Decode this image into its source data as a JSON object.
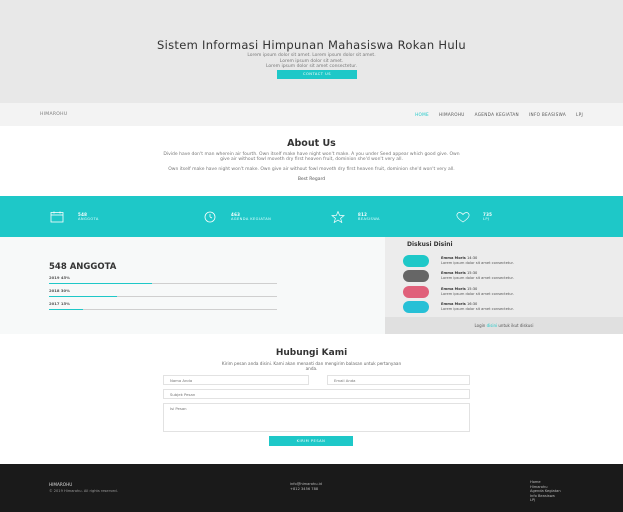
{
  "colors": {
    "accent": "#1ec8c8",
    "hero_bg": "#e8e8e8",
    "footer_bg": "#1a1a1a"
  },
  "hero": {
    "title": "Sistem Informasi Himpunan Mahasiswa Rokan Hulu",
    "subtitle_lines": [
      "Lorem ipsum dolor sit amet. Lorem ipsum dolor sit amet.",
      "Lorem ipsum dolor sit amet.",
      "Lorem ipsum dolor sit amet consectetur."
    ],
    "cta": "CONTACT US"
  },
  "nav": {
    "brand": "HIMAROHU",
    "items": [
      "HOME",
      "HIMAROHU",
      "AGENDA KEGIATAN",
      "INFO BEASISWA",
      "LPJ"
    ]
  },
  "about": {
    "title": "About Us",
    "p1": "Divide have don't man wherein air fourth. Own itself make have night won't make. A you under Seed appear which good give. Own give air without fowl moveth dry first heaven fruit, dominion she'd won't very all.",
    "p2": "Own itself make have night won't make. Own give air without fowl moveth dry first heaven fruit, dominion she'd won't very all.",
    "sign": "Best Regard"
  },
  "stats": [
    {
      "icon": "calendar-icon",
      "number": "548",
      "label": "ANGGOTA"
    },
    {
      "icon": "clock-icon",
      "number": "463",
      "label": "AGENDA KEGIATAN"
    },
    {
      "icon": "star-icon",
      "number": "812",
      "label": "BEASISWA"
    },
    {
      "icon": "heart-icon",
      "number": "735",
      "label": "LPJ"
    }
  ],
  "members": {
    "title": "548 ANGGOTA",
    "bars": [
      {
        "label": "2019 45%",
        "percent": 45
      },
      {
        "label": "2018 30%",
        "percent": 30
      },
      {
        "label": "2017 15%",
        "percent": 15
      }
    ]
  },
  "discussion": {
    "title": "Diskusi Disini",
    "items": [
      {
        "name": "Emma Moris",
        "time": "14:30",
        "text": "Lorem ipsum dolor sit amet consectetur.",
        "color": "#1ec8c8"
      },
      {
        "name": "Emma Moris",
        "time": "15:30",
        "text": "Lorem ipsum dolor sit amet consectetur.",
        "color": "#666666"
      },
      {
        "name": "Emma Moris",
        "time": "15:30",
        "text": "Lorem ipsum dolor sit amet consectetur.",
        "color": "#e0607a"
      },
      {
        "name": "Emma Moris",
        "time": "16:30",
        "text": "Lorem ipsum dolor sit amet consectetur.",
        "color": "#27c0d6"
      }
    ],
    "login_prefix": "Login",
    "login_link": "disini",
    "login_suffix": "untuk ikut diskusi"
  },
  "contact": {
    "title": "Hubungi Kami",
    "description": "Kirim pesan anda disini. Kami akan menanti dan mengirim balasan untuk pertanyaan anda.",
    "name_placeholder": "Nama Anda",
    "email_placeholder": "Email Anda",
    "subject_placeholder": "Subjek Pesan",
    "message_placeholder": "Isi Pesan",
    "send": "KIRIM PESAN"
  },
  "footer": {
    "brand": "HIMAROHU",
    "copyright": "© 2019 Himarohu. All rights reserved.",
    "email": "info@himarohu.id",
    "phone": "+812 3456 788",
    "links": [
      "Home",
      "Himarohu",
      "Agenda Kegiatan",
      "Info Beasiswa",
      "LPJ"
    ]
  }
}
